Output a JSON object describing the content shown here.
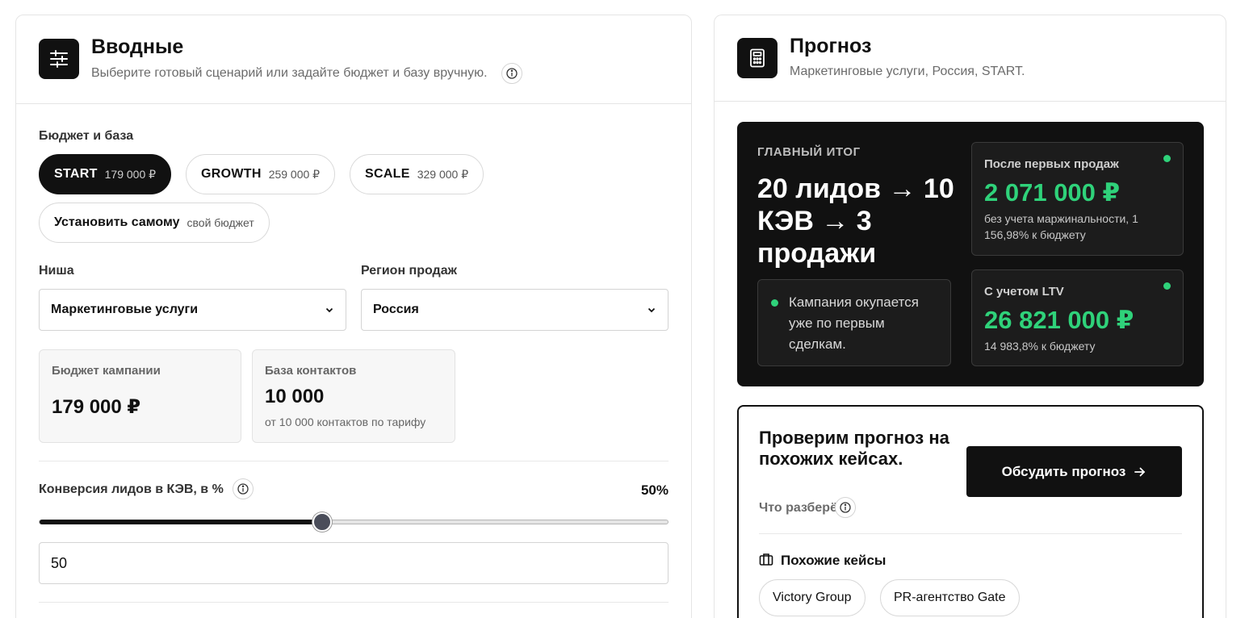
{
  "inputs_panel": {
    "title": "Вводные",
    "subtitle": "Выберите готовый сценарий или задайте бюджет и базу вручную.",
    "budget_section_label": "Бюджет и база",
    "plans": [
      {
        "name": "START",
        "price": "179 000 ₽",
        "active": true
      },
      {
        "name": "GROWTH",
        "price": "259 000 ₽",
        "active": false
      },
      {
        "name": "SCALE",
        "price": "329 000 ₽",
        "active": false
      }
    ],
    "custom_plan": {
      "name": "Установить самому",
      "price": "свой бюджет"
    },
    "niche": {
      "label": "Ниша",
      "value": "Маркетинговые услуги"
    },
    "region": {
      "label": "Регион продаж",
      "value": "Россия"
    },
    "budget_card": {
      "label": "Бюджет кампании",
      "value": "179 000 ₽"
    },
    "contacts_card": {
      "label": "База контактов",
      "value": "10 000",
      "note": "от 10 000 контактов по тарифу"
    },
    "conversion": {
      "label": "Конверсия лидов в КЭВ, в %",
      "display": "50%",
      "value": "50",
      "fraction": 0.45
    }
  },
  "forecast_panel": {
    "title": "Прогноз",
    "subtitle": "Маркетинговые услуги, Россия, START.",
    "summary": {
      "kicker": "ГЛАВНЫЙ ИТОГ",
      "headline": "20 лидов → 10 КЭВ → 3 продажи",
      "note": "Кампания окупается уже по первым сделкам."
    },
    "first_sales": {
      "title": "После первых продаж",
      "value": "2 071 000 ₽",
      "note": "без учета маржинальности, 1 156,98% к бюджету"
    },
    "ltv": {
      "title": "С учетом LTV",
      "value": "26 821 000 ₽",
      "note": "14 983,8% к бюджету"
    },
    "cta": {
      "headline": "Проверим прогноз на похожих кейсах.",
      "sub": "Что разберём",
      "button": "Обсудить прогноз",
      "cases_title": "Похожие кейсы",
      "cases": [
        "Victory Group",
        "PR-агентство Gate"
      ]
    }
  },
  "colors": {
    "accent": "#111111",
    "positive": "#2fd27a",
    "muted": "#6b6b6b"
  }
}
